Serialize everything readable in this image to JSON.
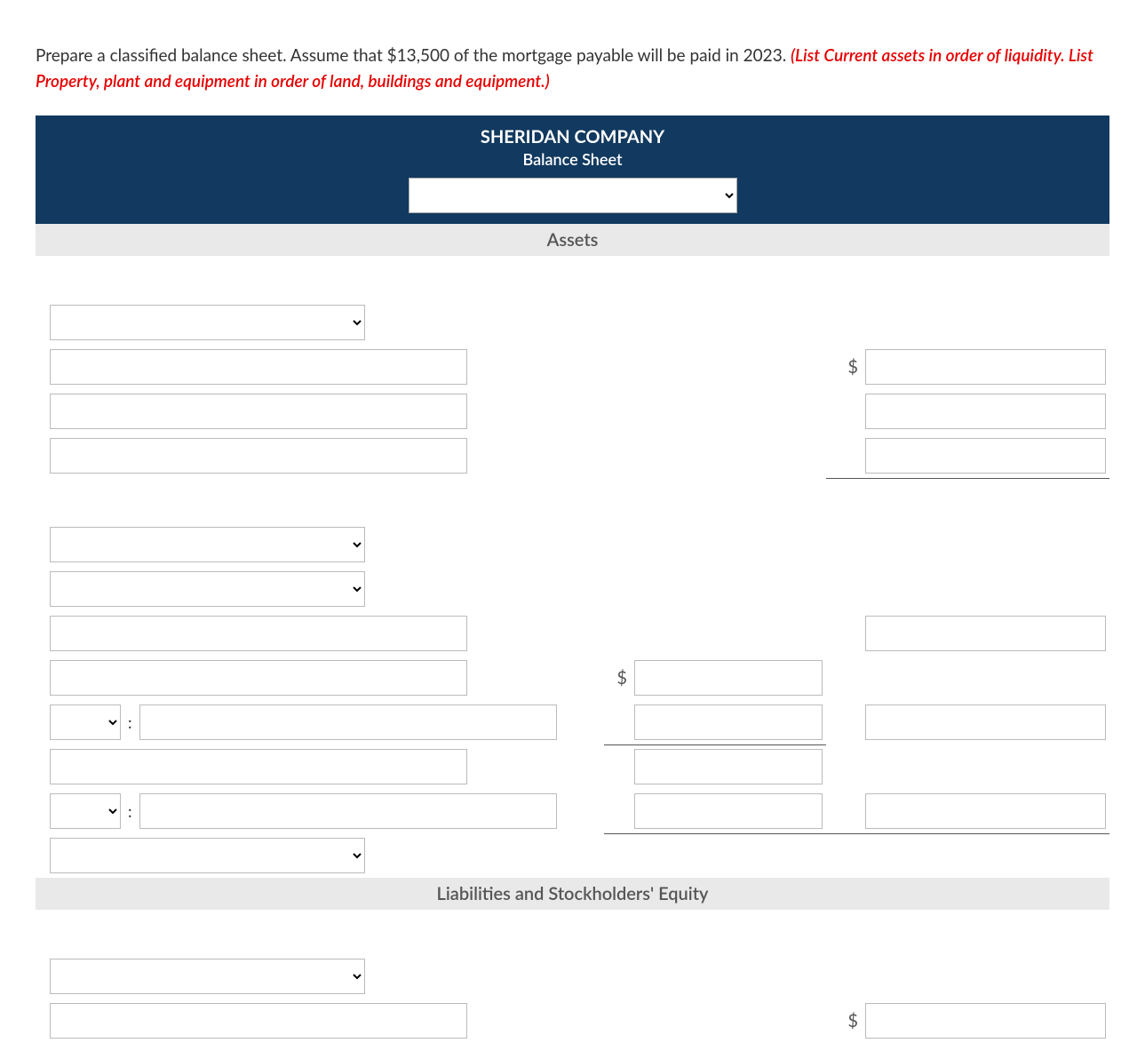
{
  "instruction_plain": "Prepare a classified balance sheet. Assume that $13,500 of the mortgage payable will be paid in 2023. ",
  "instruction_hint": "(List Current assets in order of liquidity. List Property, plant and equipment in order of land, buildings and equipment.)",
  "company": "SHERIDAN COMPANY",
  "statement": "Balance Sheet",
  "date_value": "",
  "sections": {
    "assets": "Assets",
    "liab": "Liabilities and Stockholders' Equity"
  },
  "currency": "$",
  "colon": ":",
  "rows": {
    "a_head1": "",
    "a_line1_label": "",
    "a_line1_amt2": "",
    "a_line2_label": "",
    "a_line2_amt2": "",
    "a_line3_label": "",
    "a_line3_amt2": "",
    "a_head2": "",
    "a_head3": "",
    "a_line4_label": "",
    "a_line4_amt2": "",
    "a_line5_label": "",
    "a_line5_amt1": "",
    "a_pair1_sel": "",
    "a_pair1_txt": "",
    "a_pair1_amt1": "",
    "a_pair1_amt2": "",
    "a_line6_label": "",
    "a_line6_amt1": "",
    "a_pair2_sel": "",
    "a_pair2_txt": "",
    "a_pair2_amt1": "",
    "a_pair2_amt2": "",
    "a_head4": "",
    "l_head1": "",
    "l_line1_label": "",
    "l_line1_amt2": ""
  }
}
